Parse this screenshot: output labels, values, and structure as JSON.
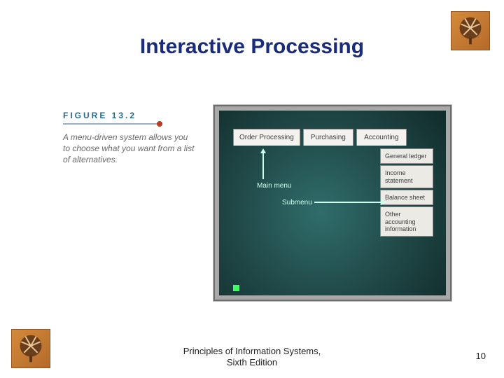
{
  "title": "Interactive Processing",
  "figure": {
    "label": "FIGURE 13.2",
    "description": "A menu-driven system allows you to choose what you want from a list of alternatives."
  },
  "diagram": {
    "main_menu_label": "Main menu",
    "submenu_label": "Submenu",
    "tabs": [
      "Order Processing",
      "Purchasing",
      "Accounting"
    ],
    "submenu_items": [
      "General ledger",
      "Income statement",
      "Balance sheet",
      "Other accounting information"
    ]
  },
  "footer": {
    "line1": "Principles of Information Systems,",
    "line2": "Sixth Edition"
  },
  "page_number": "10"
}
